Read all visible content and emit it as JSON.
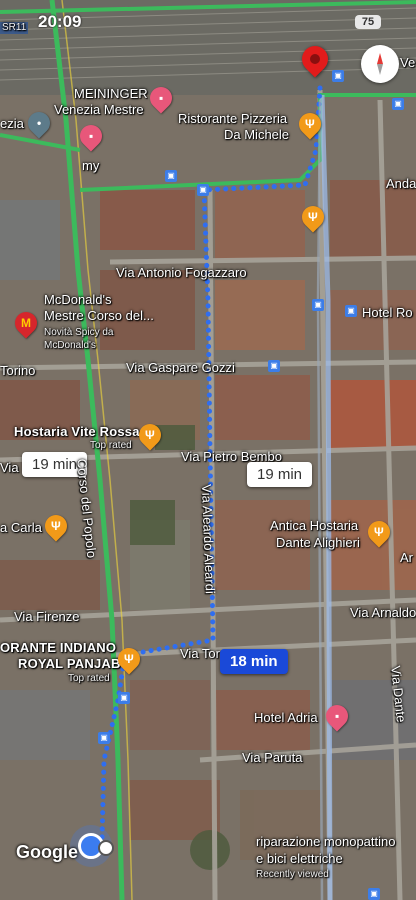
{
  "status": {
    "time": "20:09",
    "battery": "75"
  },
  "route_chips": [
    {
      "text": "19 min",
      "selected": false
    },
    {
      "text": "19 min",
      "selected": false
    },
    {
      "text": "18 min",
      "selected": true
    }
  ],
  "places": {
    "meininger_1": "MEININGER",
    "meininger_2": "Venezia Mestre",
    "ristorante_1": "Ristorante Pizzeria",
    "ristorante_2": "Da Michele",
    "mcdonalds_1": "McDonald's",
    "mcdonalds_2": "Mestre Corso del...",
    "mcdonalds_3": "Novità Spicy da",
    "mcdonalds_4": "McDonald's",
    "hostaria_1": "Hostaria Vite Rossa",
    "hostaria_2": "Top rated",
    "antica_1": "Antica Hostaria",
    "antica_2": "Dante Alighieri",
    "indiano_1": "ORANTE INDIANO",
    "indiano_2": "ROYAL PANJAB",
    "indiano_3": "Top rated",
    "hotel_adria": "Hotel Adria",
    "riparazione_1": "riparazione monopattino",
    "riparazione_2": "e bici elettriche",
    "riparazione_3": "Recently viewed",
    "hotel_ro": "Hotel Ro",
    "anda": "Anda",
    "ezia": "ezia",
    "my": "my",
    "ve": "Ve",
    "a_carla": "a Carla",
    "ar": "Ar"
  },
  "streets": {
    "fogazzaro": "Via Antonio Fogazzaro",
    "gozzi": "Via Gaspare Gozzi",
    "bembo": "Via Pietro Bembo",
    "aleardi": "Via Aleardo Aleardi",
    "corso_popolo": "Corso del Popolo",
    "torino": "Torino",
    "via_left": "Via",
    "firenze": "Via Firenze",
    "via_tor": "Via Tor",
    "arnaldo": "Via Arnaldo",
    "dante": "Via Dante",
    "paruta": "Via Paruta",
    "sr11": "SR11"
  },
  "google_logo": "Google",
  "colors": {
    "route": "#2f6ef0",
    "selected_chip": "#1a49d8",
    "dest_pin": "#e21b1b"
  }
}
